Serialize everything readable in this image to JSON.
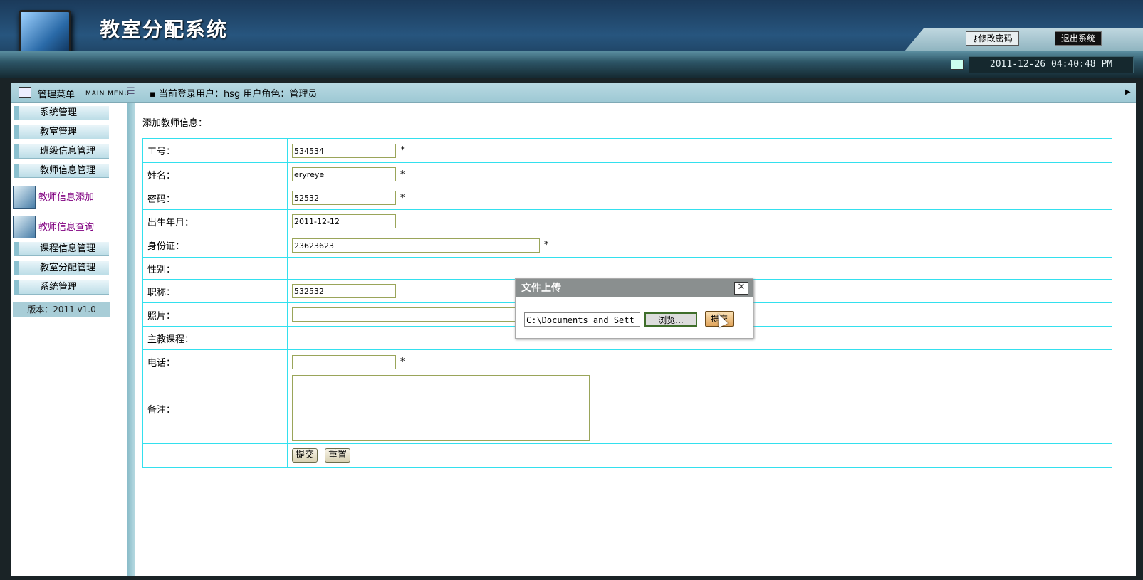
{
  "header": {
    "title": "教室分配系统",
    "change_password": "修改密码",
    "logout": "退出系统",
    "datetime": "2011-12-26 04:40:48 PM"
  },
  "menubar": {
    "title": "管理菜单",
    "subtitle": "MAIN MENU",
    "user_info": "▪ 当前登录用户：hsg  用户角色：管理员"
  },
  "sidebar": {
    "items": [
      "系统管理",
      "教室管理",
      "班级信息管理",
      "教师信息管理"
    ],
    "links": [
      "教师信息添加",
      "教师信息查询"
    ],
    "items_after": [
      "课程信息管理",
      "教室分配管理",
      "系统管理"
    ],
    "version": "版本：2011 v1.0"
  },
  "form": {
    "heading": "添加教师信息：",
    "labels": {
      "id": "工号：",
      "name": "姓名：",
      "password": "密码：",
      "birth": "出生年月：",
      "idcard": "身份证：",
      "gender": "性别：",
      "title": "职称：",
      "photo": "照片：",
      "course": "主教课程：",
      "phone": "电话：",
      "remark": "备注："
    },
    "values": {
      "id": "534534",
      "name": "eryreye",
      "password": "52532",
      "birth": "2011-12-12",
      "idcard": "23623623",
      "title": "532532",
      "photo": "",
      "phone": ""
    },
    "required_mark": "*",
    "submit": "提交",
    "reset": "重置"
  },
  "dialog": {
    "title": "文件上传",
    "path": "C:\\Documents and Sett",
    "browse": "浏览...",
    "submit": "提交",
    "close": "✕"
  }
}
